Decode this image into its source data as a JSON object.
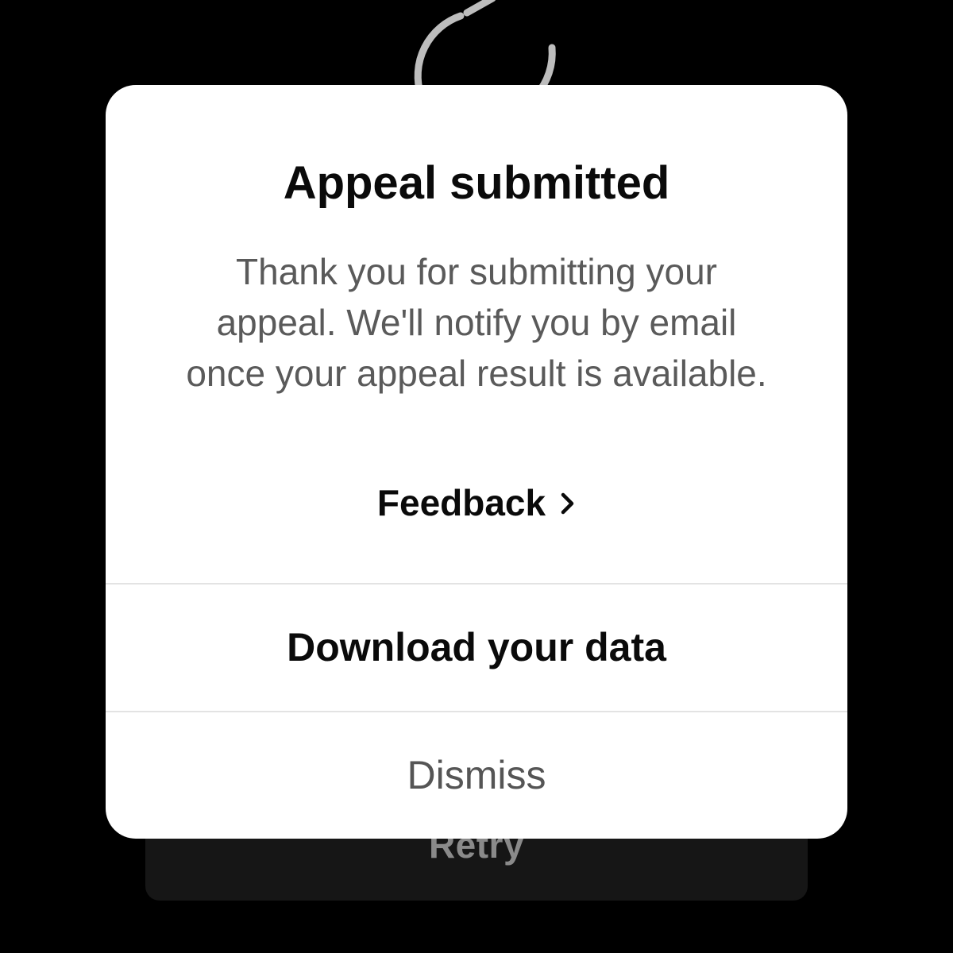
{
  "background": {
    "retry_label": "Retry",
    "icon": "refresh-icon"
  },
  "dialog": {
    "title": "Appeal submitted",
    "message": "Thank you for submitting your appeal. We'll notify you by email once your appeal result is available.",
    "feedback_label": "Feedback",
    "feedback_icon": "chevron-right-icon",
    "actions": {
      "download_label": "Download your data",
      "dismiss_label": "Dismiss"
    }
  },
  "colors": {
    "background": "#000000",
    "dialog": "#ffffff",
    "title_text": "#0a0a0a",
    "body_text": "#5a5a5a",
    "dismiss_text": "#555555",
    "divider": "#e3e3e3"
  }
}
